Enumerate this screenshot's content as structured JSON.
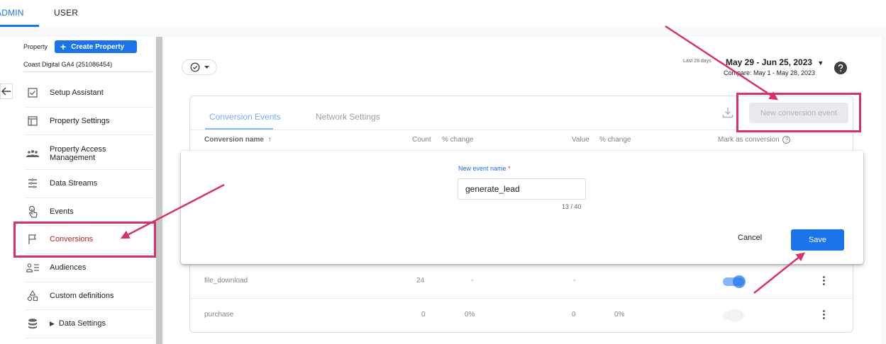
{
  "top_tabs": {
    "admin": "ADMIN",
    "user": "USER"
  },
  "sidebar": {
    "property_label": "Property",
    "create_property": "Create Property",
    "property_name": "Coast Digital GA4 (251086454)",
    "items": [
      {
        "label": "Setup Assistant",
        "icon": "checkbox-icon"
      },
      {
        "label": "Property Settings",
        "icon": "window-icon"
      },
      {
        "label": "Property Access Management",
        "icon": "people-icon"
      },
      {
        "label": "Data Streams",
        "icon": "streams-icon"
      },
      {
        "label": "Events",
        "icon": "touch-icon"
      },
      {
        "label": "Conversions",
        "icon": "flag-icon"
      },
      {
        "label": "Audiences",
        "icon": "audience-icon"
      },
      {
        "label": "Custom definitions",
        "icon": "shapes-icon"
      },
      {
        "label": "Data Settings",
        "icon": "database-icon"
      }
    ]
  },
  "header": {
    "date_small": "Last 28 days",
    "date_range": "May 29 - Jun 25, 2023",
    "compare": "Compare: May 1 - May 28, 2023"
  },
  "tabs": {
    "conversion_events": "Conversion Events",
    "network_settings": "Network Settings"
  },
  "new_conversion_button": "New conversion event",
  "table": {
    "headers": {
      "name": "Conversion name",
      "count": "Count",
      "count_change": "% change",
      "value": "Value",
      "value_change": "% change",
      "mark": "Mark as conversion"
    },
    "rows": [
      {
        "name": "file_download",
        "count": "24",
        "count_change": "-",
        "value": "-",
        "value_change": "",
        "mark": true
      },
      {
        "name": "purchase",
        "count": "0",
        "count_change": "0%",
        "value": "0",
        "value_change": "0%",
        "mark": false
      }
    ]
  },
  "dialog": {
    "field_label": "New event name",
    "required_mark": "*",
    "value": "generate_lead",
    "counter": "13 / 40",
    "cancel": "Cancel",
    "save": "Save"
  },
  "colors": {
    "accent": "#1a73e8",
    "highlight": "#d6336c",
    "active_nav": "#b3261e"
  }
}
